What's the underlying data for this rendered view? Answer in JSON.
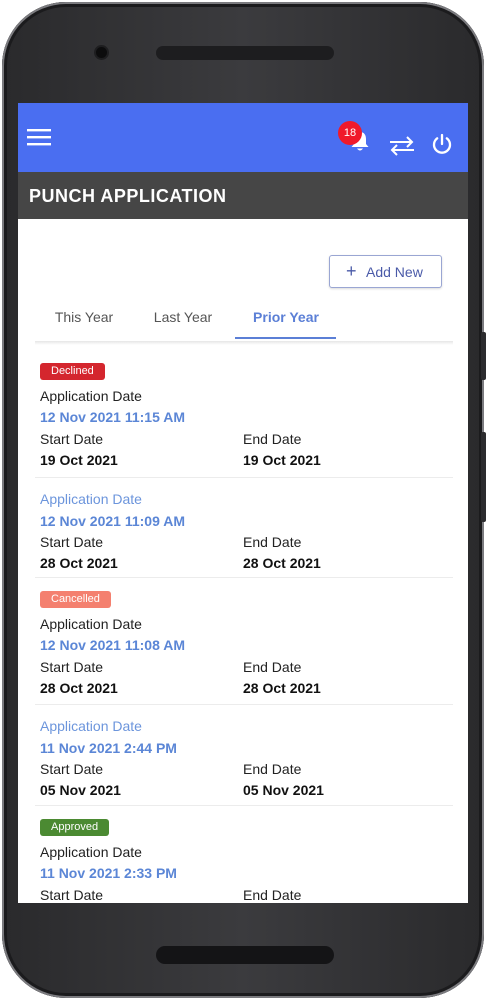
{
  "header": {
    "notification_count": "18"
  },
  "page": {
    "title": "PUNCH APPLICATION"
  },
  "actions": {
    "add_new_label": "Add New"
  },
  "tabs": [
    {
      "label": "This Year",
      "active": false
    },
    {
      "label": "Last Year",
      "active": false
    },
    {
      "label": "Prior Year",
      "active": true
    }
  ],
  "labels": {
    "application_date": "Application Date",
    "start_date": "Start Date",
    "end_date": "End Date"
  },
  "applications": [
    {
      "status": "Declined",
      "status_color": "#d4262e",
      "application_date": "12 Nov 2021 11:15 AM",
      "start_date": "19 Oct 2021",
      "end_date": "19 Oct 2021"
    },
    {
      "status": "",
      "status_color": "",
      "application_date": "12 Nov 2021 11:09 AM",
      "start_date": "28 Oct 2021",
      "end_date": "28 Oct 2021"
    },
    {
      "status": "Cancelled",
      "status_color": "#f4806f",
      "application_date": "12 Nov 2021 11:08 AM",
      "start_date": "28 Oct 2021",
      "end_date": "28 Oct 2021"
    },
    {
      "status": "",
      "status_color": "",
      "application_date": "11 Nov 2021 2:44 PM",
      "start_date": "05 Nov 2021",
      "end_date": "05 Nov 2021"
    },
    {
      "status": "Approved",
      "status_color": "#4b8a32",
      "application_date": "11 Nov 2021 2:33 PM",
      "start_date": "",
      "end_date": ""
    }
  ],
  "colors": {
    "appbar": "#4a6ef1",
    "titlebar": "#464646",
    "accent": "#5b7fd6"
  },
  "icons": [
    "menu-icon",
    "bell-icon",
    "switch-arrows-icon",
    "power-icon",
    "plus-icon"
  ]
}
